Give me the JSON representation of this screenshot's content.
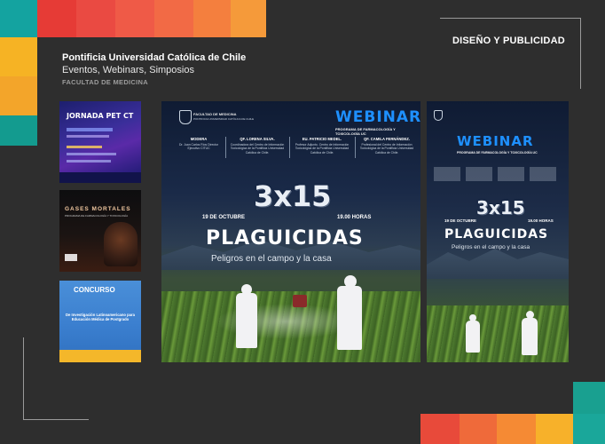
{
  "header": {
    "university": "Pontificia Universidad Católica de Chile",
    "category": "Eventos, Webinars, Simposios",
    "faculty": "FACULTAD DE MEDICINA",
    "section_title": "DISEÑO Y PUBLICIDAD"
  },
  "thumbnails": [
    {
      "title": "JORNADA PET CT"
    },
    {
      "title": "GASES MORTALES",
      "subtitle": "PROGRAMA DE FARMACOLOGÍA Y TOXICOLOGÍA"
    },
    {
      "title": "CONCURSO",
      "body": "De Investigación Latinoamericano para Educación Médica de Postgrado"
    }
  ],
  "poster_main": {
    "logo_line1": "FACULTAD DE MEDICINA",
    "logo_line2": "PONTIFICIA UNIVERSIDAD CATÓLICA DE CHILE",
    "webinar": "WEBINAR",
    "program": "PROGRAMA DE FARMACOLOGÍA Y TOXICOLOGÍA UC",
    "speakers": [
      {
        "name": "MODERA",
        "role": "Dr. Juan Carlos Ríos Director Ejecutivo CITUC"
      },
      {
        "name": "QF. LORENA SILVA.",
        "role": "Coordinadora del Centro de Información Toxicológica de la Pontificia Universidad Católica de Chile."
      },
      {
        "name": "EU. PATRICIO MEDEL.",
        "role": "Profesor Adjunto. Centro de Información Toxicológica de la Pontificia Universidad Católica de Chile."
      },
      {
        "name": "QF. CAMILA FERNÁNDEZ.",
        "role": "Profesional del Centro de Información Toxicológica de la Pontificia Universidad Católica de Chile."
      }
    ],
    "number": "3x15",
    "date": "19 DE OCTUBRE",
    "time": "19.00 HORAS",
    "headline": "PLAGUICIDAS",
    "tagline": "Peligros en el campo y la casa"
  },
  "poster_side": {
    "webinar": "WEBINAR",
    "program": "PROGRAMA DE FARMACOLOGÍA Y TOXICOLOGÍA UC",
    "number": "3x15",
    "date": "19 DE OCTUBRE",
    "time": "19.00 HORAS",
    "headline": "PLAGUICIDAS",
    "tagline": "Peligros en el campo y la casa"
  },
  "colors": {
    "background": "#2e2e2e",
    "red": "#e8453c",
    "orange": "#f0882a",
    "yellow": "#f7b924",
    "teal": "#1a9e8e",
    "webinar_blue": "#1e90ff"
  }
}
